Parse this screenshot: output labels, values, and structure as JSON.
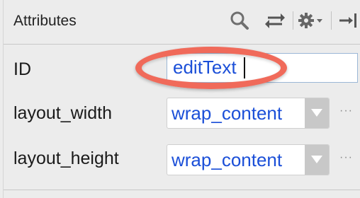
{
  "header": {
    "title": "Attributes",
    "icons": [
      "search-icon",
      "swap-icon",
      "gear-icon",
      "collapse-panel-icon"
    ]
  },
  "rows": {
    "id": {
      "label": "ID",
      "value": "editText"
    },
    "layout_width": {
      "label": "layout_width",
      "value": "wrap_content",
      "more": "···"
    },
    "layout_height": {
      "label": "layout_height",
      "value": "wrap_content",
      "more": "···"
    }
  },
  "colors": {
    "highlight": "#f06a5a",
    "value_text": "#1b4fd8",
    "panel_bg": "#ececec"
  }
}
